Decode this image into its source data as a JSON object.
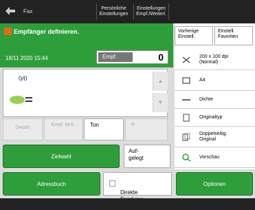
{
  "topbar": {
    "logo_label": "Fax",
    "buttons": [
      "Persönliche Einstellungen",
      "Einstellungen Empf./Weiterl."
    ]
  },
  "header": {
    "title": "Empfänger definieren."
  },
  "status": {
    "datetime": "18/11 2020 15:44",
    "empf_label": "Empf.",
    "empf_count": "0"
  },
  "list": {
    "count": "0/0"
  },
  "tabs": {
    "details": "Details",
    "empf_bsch": "Empf. löch.",
    "ton": "Ton",
    "r": "R"
  },
  "buttons": {
    "zielwahl": "Zielwahl",
    "aufgelegt": "Auf-\ngelegt",
    "adressbuch": "Adressbuch",
    "direkte": "Direkte\nSendung",
    "optionen": "Optionen"
  },
  "right_panel": {
    "top": [
      "Vorherige Einstell.",
      "Einstell. Favoriten"
    ],
    "items": [
      {
        "label": "200 x 100 dpi (Normal)",
        "icon": "resolution-icon"
      },
      {
        "label": "A4",
        "icon": "paper-size-icon"
      },
      {
        "label": "Dichte",
        "icon": "density-icon"
      },
      {
        "label": "Originaltyp",
        "icon": "original-type-icon"
      },
      {
        "label": "Doppelseitig. Original",
        "icon": "duplex-original-icon"
      },
      {
        "label": "Vorschau",
        "icon": "preview-icon"
      }
    ]
  },
  "colors": {
    "accent_green": "#2e9e3b",
    "header_icon_orange": "#e46a17",
    "topbar": "#222222"
  }
}
